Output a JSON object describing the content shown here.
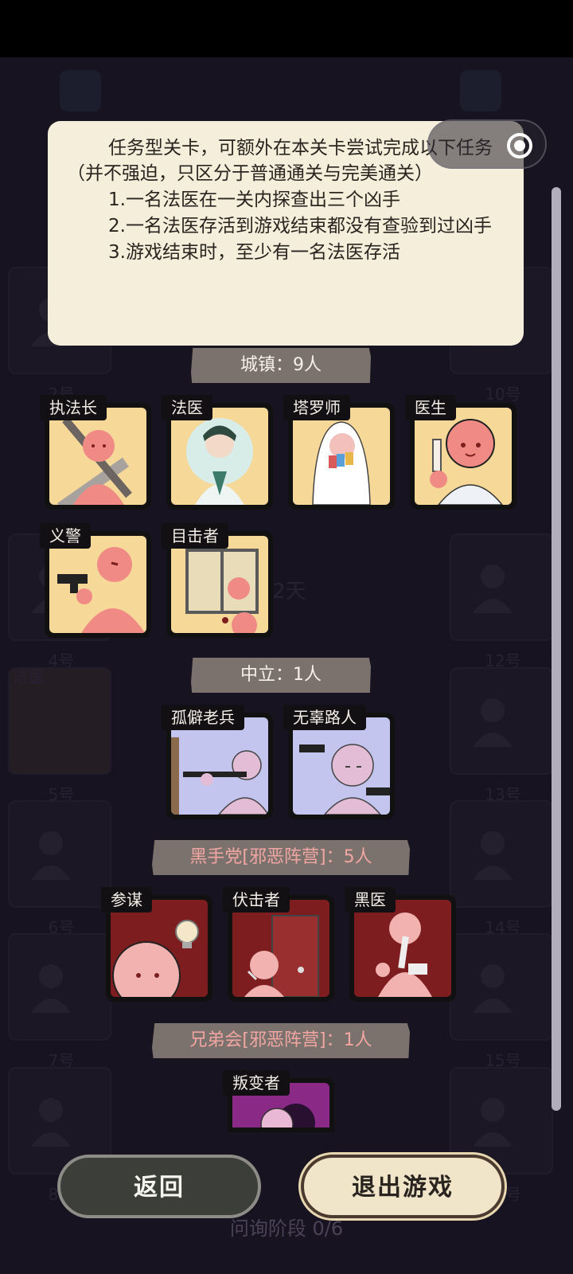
{
  "tooltip": {
    "lines": [
      "任务型关卡，可额外在本关卡尝试完成以下任务（并不强迫，只区分于普通通关与完美通关）",
      "1.一名法医在一关内探查出三个凶手",
      "2.一名法医存活到游戏结束都没有查验到过凶手",
      "3.游戏结束时，至少有一名法医存活"
    ]
  },
  "sections": {
    "town": "城镇：9人",
    "neutral": "中立：1人",
    "blackhand": "黑手党[邪恶阵营]：5人",
    "brotherhood": "兄弟会[邪恶阵营]：1人"
  },
  "roles": {
    "town": [
      "执法长",
      "法医",
      "塔罗师",
      "医生",
      "义警",
      "目击者"
    ],
    "neutral": [
      "孤僻老兵",
      "无辜路人"
    ],
    "blackhand": [
      "参谋",
      "伏击者",
      "黑医"
    ],
    "brotherhood": [
      "叛变者"
    ]
  },
  "background": {
    "slots_left": [
      "2号",
      "4号",
      "5号",
      "6号",
      "7号",
      "8号"
    ],
    "slots_right": [
      "10号",
      "12号",
      "13号",
      "14号",
      "15号",
      "16号"
    ],
    "day_text": "2天",
    "dead_tag": "法医"
  },
  "buttons": {
    "back": "返回",
    "quit": "退出游戏"
  },
  "status": "问询阶段 0/6",
  "colors": {
    "tooltip_bg": "#f4eedb",
    "town_card": "#f6d898",
    "neutral_card": "#c3c5ee",
    "evil_card": "#7e1d20",
    "traitor_card": "#8a2a86",
    "evil_label": "#f2a6a2"
  },
  "icons": [
    "map-icon",
    "edit-icon",
    "unknown-player-icon",
    "toggle-icon"
  ]
}
